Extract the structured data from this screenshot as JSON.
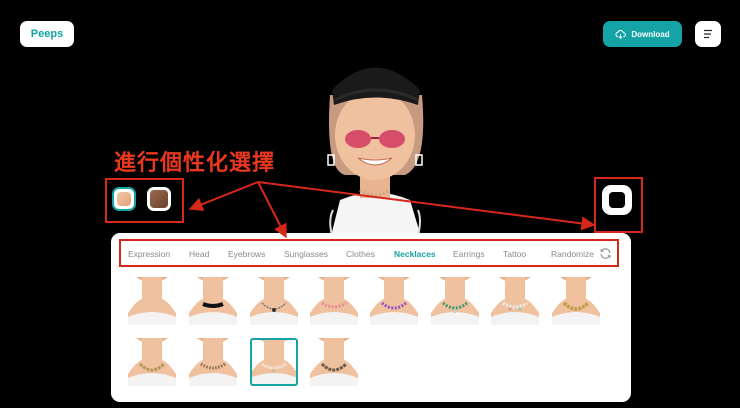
{
  "app": {
    "logo_label": "Peeps",
    "download_label": "Download"
  },
  "annotation": {
    "text": "進行個性化選擇",
    "color": "#e8391f"
  },
  "accent_color": "#16a3a6",
  "tabs": [
    {
      "label": "Expression",
      "active": false
    },
    {
      "label": "Head",
      "active": false
    },
    {
      "label": "Eyebrows",
      "active": false
    },
    {
      "label": "Sunglasses",
      "active": false
    },
    {
      "label": "Clothes",
      "active": false
    },
    {
      "label": "Necklaces",
      "active": true
    },
    {
      "label": "Earrings",
      "active": false
    },
    {
      "label": "Tattoo",
      "active": false
    },
    {
      "label": "Randomize",
      "active": false
    }
  ],
  "necklace_options": [
    {
      "name": "none",
      "selected": false
    },
    {
      "name": "black-choker",
      "selected": false
    },
    {
      "name": "silver-chain-pendant",
      "selected": false
    },
    {
      "name": "pink-beads",
      "selected": false
    },
    {
      "name": "purple-beads",
      "selected": false
    },
    {
      "name": "green-beads",
      "selected": false
    },
    {
      "name": "pearl-charms",
      "selected": false
    },
    {
      "name": "gold-cuban-chain",
      "selected": false
    },
    {
      "name": "gold-chain",
      "selected": false
    },
    {
      "name": "gold-beads",
      "selected": false
    },
    {
      "name": "pearl-strand",
      "selected": true
    },
    {
      "name": "dark-chain",
      "selected": false
    }
  ],
  "skin_swatches": [
    {
      "name": "light",
      "selected": true
    },
    {
      "name": "brown",
      "selected": false
    }
  ]
}
